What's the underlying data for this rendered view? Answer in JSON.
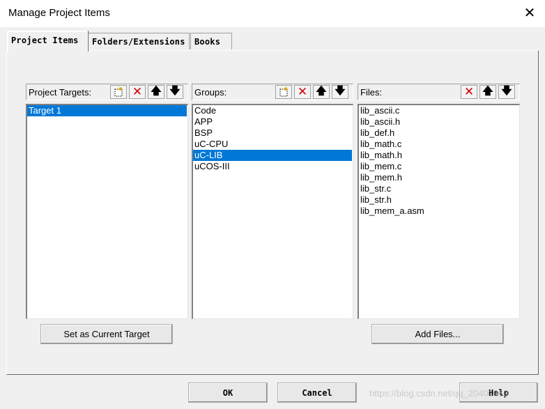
{
  "window": {
    "title": "Manage Project Items",
    "close_glyph": "✕"
  },
  "tabs": [
    {
      "label": "Project Items",
      "active": true
    },
    {
      "label": "Folders/Extensions",
      "active": false
    },
    {
      "label": "Books",
      "active": false
    }
  ],
  "targets": {
    "header": "Project Targets:",
    "items": [
      "Target 1"
    ],
    "selected": "Target 1",
    "toolbar_icons": [
      "new-icon",
      "delete-icon",
      "move-up-icon",
      "move-down-icon"
    ],
    "action_button": "Set as Current Target"
  },
  "groups": {
    "header": "Groups:",
    "items": [
      "Code",
      "APP",
      "BSP",
      "uC-CPU",
      "uC-LIB",
      "uCOS-III"
    ],
    "selected": "uC-LIB",
    "toolbar_icons": [
      "new-icon",
      "delete-icon",
      "move-up-icon",
      "move-down-icon"
    ]
  },
  "files": {
    "header": "Files:",
    "items": [
      "lib_ascii.c",
      "lib_ascii.h",
      "lib_def.h",
      "lib_math.c",
      "lib_math.h",
      "lib_mem.c",
      "lib_mem.h",
      "lib_str.c",
      "lib_str.h",
      "lib_mem_a.asm"
    ],
    "toolbar_icons": [
      "delete-icon",
      "move-up-icon",
      "move-down-icon"
    ],
    "action_button": "Add Files..."
  },
  "footer": {
    "ok": "OK",
    "cancel": "Cancel",
    "help": "Help"
  },
  "glyphs": {
    "delete": "✕",
    "up": "🡅",
    "down": "🡇"
  },
  "watermark": "https://blog.csdn.net/qq_20401963",
  "colors": {
    "selection": "#0078d7",
    "delete_icon": "#d40000"
  }
}
